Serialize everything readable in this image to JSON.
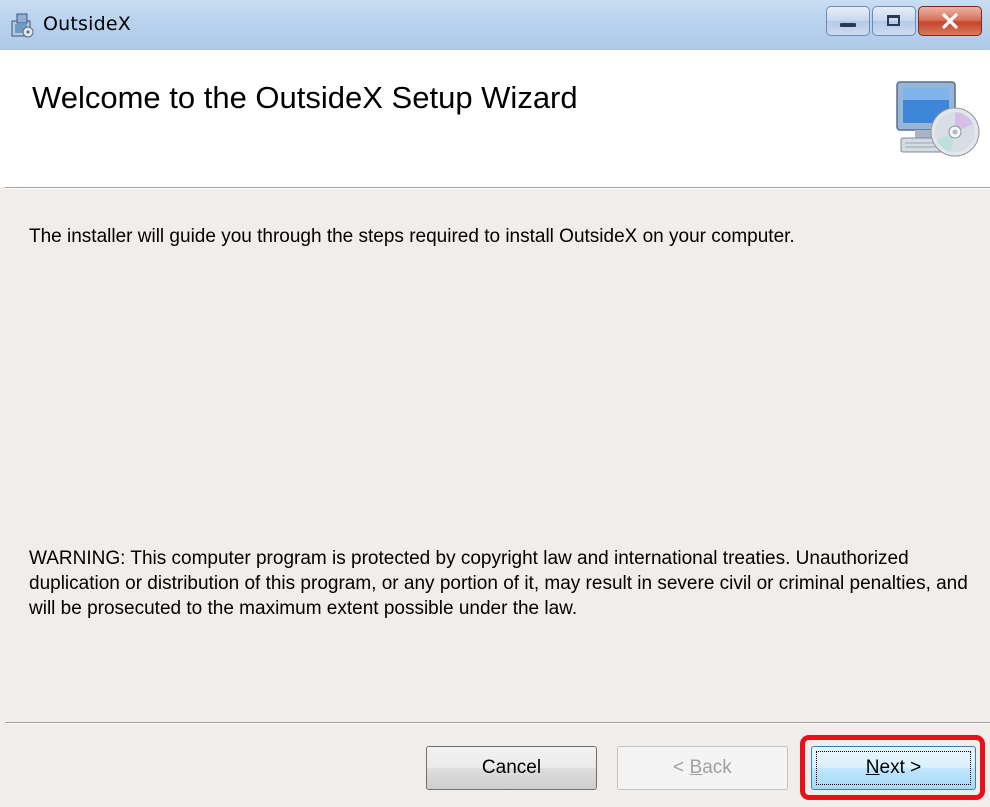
{
  "window": {
    "title": "OutsideX",
    "app_icon": "installer-icon",
    "controls": {
      "minimize_icon": "minimize-icon",
      "maximize_icon": "maximize-icon",
      "close_icon": "close-icon"
    }
  },
  "header": {
    "title": "Welcome to the OutsideX Setup Wizard",
    "icon": "computer-cd-icon"
  },
  "body": {
    "intro": "The installer will guide you through the steps required to install OutsideX on your computer.",
    "warning": "WARNING: This computer program is protected by copyright law and international treaties. Unauthorized duplication or distribution of this program, or any portion of it, may result in severe civil or criminal penalties, and will be prosecuted to the maximum extent possible under the law."
  },
  "buttons": {
    "cancel": "Cancel",
    "back_arrow": "< ",
    "back_mnemonic": "B",
    "back_rest": "ack",
    "next_mnemonic": "N",
    "next_rest": "ext >"
  },
  "colors": {
    "highlight": "#e8101a",
    "close_button": "#c6462b",
    "titlebar": "#b9d2ee"
  }
}
